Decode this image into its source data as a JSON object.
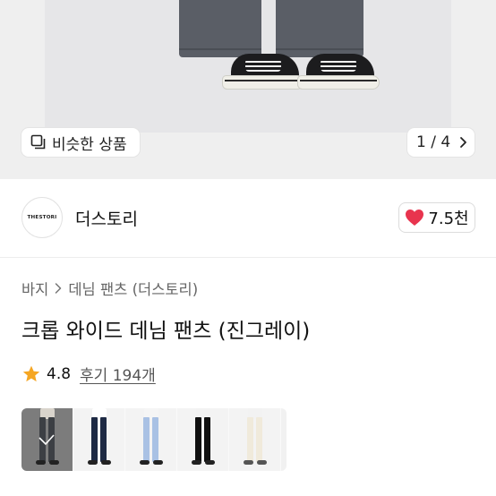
{
  "similar_products": {
    "label": "비슷한 상품"
  },
  "image_counter": {
    "text": "1 / 4"
  },
  "store": {
    "logo_text": "THESTORI",
    "name": "더스토리"
  },
  "likes": {
    "count": "7.5천"
  },
  "breadcrumb": {
    "category": "바지",
    "subcategory": "데님 팬츠 (더스토리)"
  },
  "product": {
    "title": "크롭 와이드 데님 팬츠 (진그레이)"
  },
  "rating": {
    "score": "4.8",
    "reviews_label": "후기 194개"
  },
  "colors": {
    "accent_heart": "#e8344e",
    "star": "#f5a623"
  },
  "color_options": [
    {
      "name": "진그레이",
      "selected": true
    },
    {
      "name": "네이비"
    },
    {
      "name": "연청"
    },
    {
      "name": "블랙"
    },
    {
      "name": "아이보리"
    }
  ]
}
